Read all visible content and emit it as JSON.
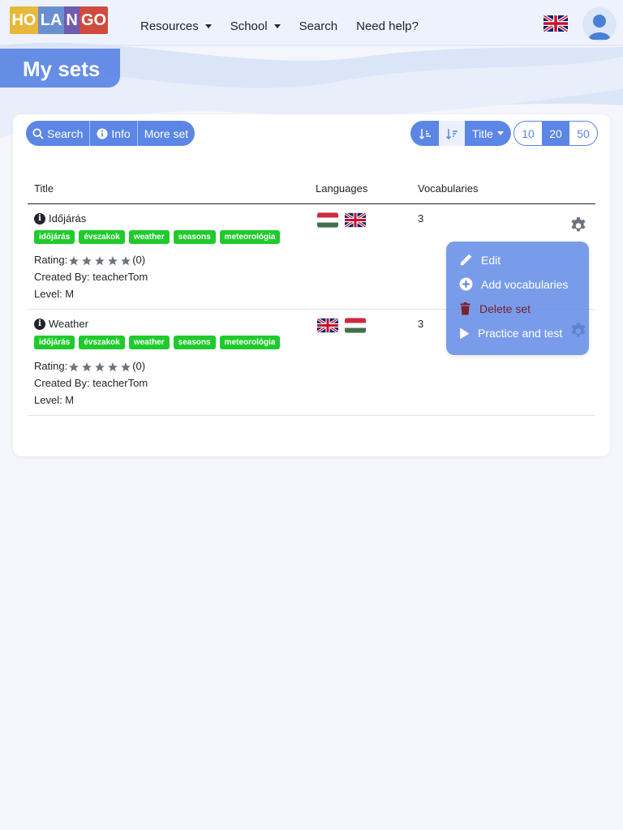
{
  "nav": {
    "logo_letters": [
      "HO",
      "LA",
      "N",
      "GO"
    ],
    "logo_colors": [
      "#e8b83a",
      "#6a8fd0",
      "#6f5bb0",
      "#d04a3d"
    ],
    "items": [
      {
        "label": "Resources",
        "dropdown": true
      },
      {
        "label": "School",
        "dropdown": true
      },
      {
        "label": "Search",
        "dropdown": false
      },
      {
        "label": "Need help?",
        "dropdown": false
      }
    ],
    "language_flag": "uk-flag-icon",
    "avatar_icon": "user-icon"
  },
  "page": {
    "title": "My sets"
  },
  "toolbar": {
    "search_label": "Search",
    "info_label": "Info",
    "more_label": "More set",
    "sort_field_label": "Title",
    "page_sizes": [
      "10",
      "20",
      "50"
    ],
    "active_page_size": "20"
  },
  "table": {
    "headers": {
      "title": "Title",
      "languages": "Languages",
      "vocabularies": "Vocabularies"
    },
    "rating_label": "Rating:",
    "created_prefix": "Created By: ",
    "level_prefix": "Level: ",
    "rows": [
      {
        "name": "Időjárás",
        "tags": [
          "időjárás",
          "évszakok",
          "weather",
          "seasons",
          "meteorológia"
        ],
        "rating": "(0)",
        "created_by": "Created By: teacherTom",
        "level": "Level: M",
        "languages": [
          "hu",
          "uk"
        ],
        "vocabularies": "3"
      },
      {
        "name": "Weather",
        "tags": [
          "időjárás",
          "évszakok",
          "weather",
          "seasons",
          "meteorológia"
        ],
        "rating": "(0)",
        "created_by": "Created By: teacherTom",
        "level": "Level: M",
        "languages": [
          "uk",
          "hu"
        ],
        "vocabularies": "3"
      }
    ]
  },
  "dropdown": {
    "items": [
      {
        "label": "Edit",
        "icon": "pencil-icon"
      },
      {
        "label": "Add vocabularies",
        "icon": "plus-circle-icon"
      },
      {
        "label": "Delete set",
        "icon": "trash-icon"
      },
      {
        "label": "Practice and test",
        "icon": "play-icon"
      }
    ]
  },
  "colors": {
    "primary": "#5b86e5",
    "tag": "#1fcb2c",
    "danger": "#7a1f2b"
  }
}
